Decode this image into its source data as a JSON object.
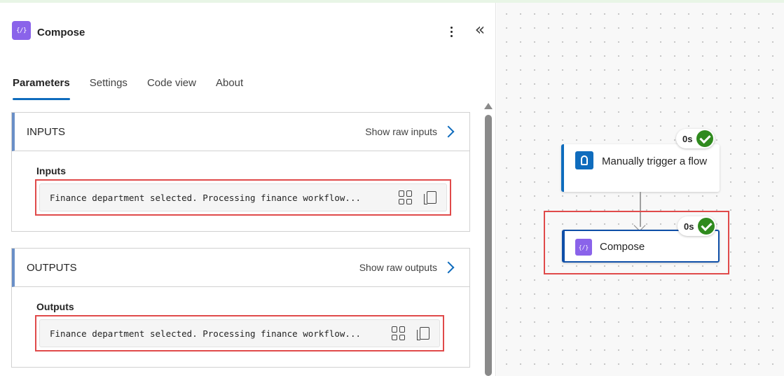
{
  "panel": {
    "title": "Compose",
    "compose_icon_glyph": "{/}",
    "tabs": [
      {
        "label": "Parameters",
        "active": true
      },
      {
        "label": "Settings",
        "active": false
      },
      {
        "label": "Code view",
        "active": false
      },
      {
        "label": "About",
        "active": false
      }
    ],
    "inputs": {
      "section_label": "INPUTS",
      "raw_link": "Show raw inputs",
      "field_label": "Inputs",
      "value": "Finance department selected. Processing finance workflow..."
    },
    "outputs": {
      "section_label": "OUTPUTS",
      "raw_link": "Show raw outputs",
      "field_label": "Outputs",
      "value": "Finance department selected. Processing finance workflow..."
    }
  },
  "canvas": {
    "nodes": [
      {
        "title": "Manually trigger a flow",
        "duration": "0s",
        "status": "succeeded",
        "icon": "manual-trigger-icon"
      },
      {
        "title": "Compose",
        "duration": "0s",
        "status": "succeeded",
        "icon": "compose-icon",
        "icon_glyph": "{/}"
      }
    ]
  },
  "colors": {
    "accent": "#0f6cbd",
    "compose_purple": "#8a63ea",
    "success_green": "#2f8a1e",
    "highlight_red": "#e04a4a"
  }
}
